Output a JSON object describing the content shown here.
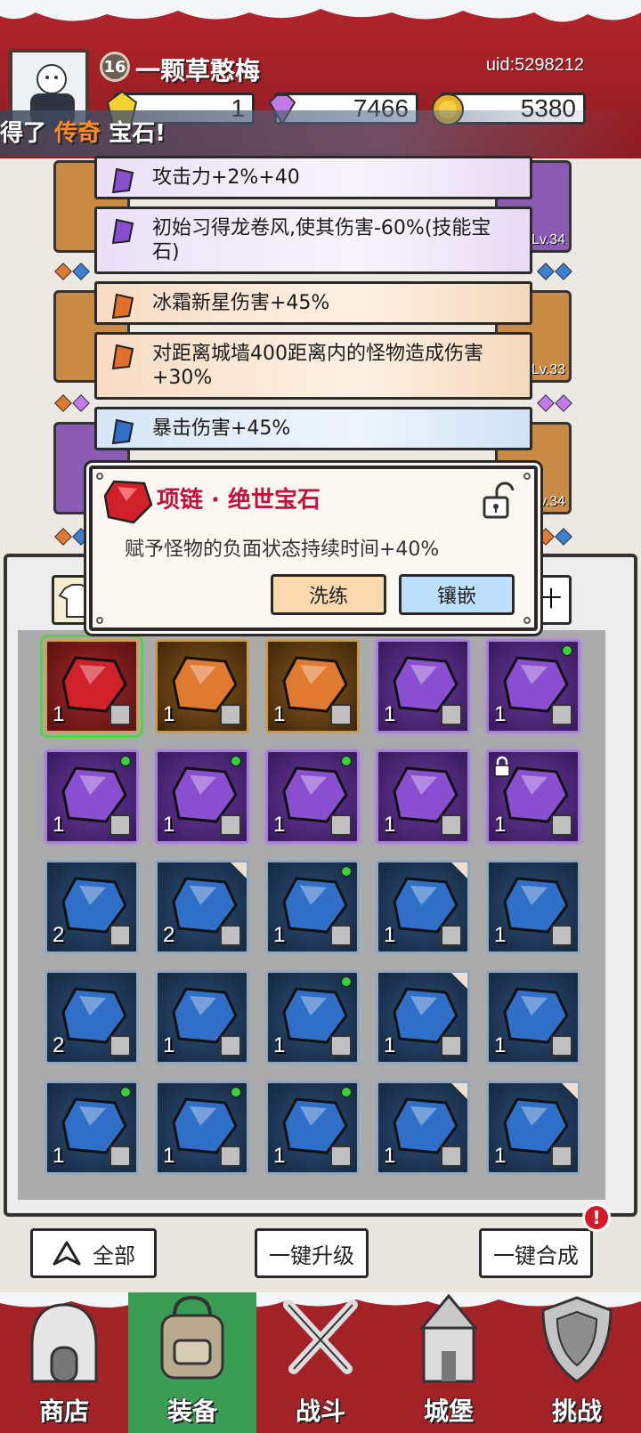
{
  "header": {
    "player_level": "16",
    "player_name": "一颗草憨梅",
    "uid": "uid:5298212",
    "currencies": [
      {
        "icon": "gold-gem-icon",
        "value": "1"
      },
      {
        "icon": "diamond-icon",
        "value": "7466"
      },
      {
        "icon": "coin-icon",
        "value": "5380"
      }
    ]
  },
  "banner": {
    "prefix": "得了",
    "highlight": "传奇",
    "suffix": "宝石!"
  },
  "equipment_levels": [
    "Lv.34",
    "Lv.33",
    "Lv.34"
  ],
  "attributes": [
    {
      "color": "purple",
      "text": "攻击力+2%+40"
    },
    {
      "color": "purple",
      "text": "初始习得龙卷风,使其伤害-60%(技能宝石)"
    },
    {
      "color": "orange",
      "text": "冰霜新星伤害+45%"
    },
    {
      "color": "orange",
      "text": "对距离城墙400距离内的怪物造成伤害+30%"
    },
    {
      "color": "blue",
      "text": "暴击伤害+45%"
    }
  ],
  "popup": {
    "title": "项链 · 绝世宝石",
    "description": "赋予怪物的负面状态持续时间+40%",
    "refine_label": "洗练",
    "inlay_label": "镶嵌"
  },
  "inventory_tab_right": "十",
  "inventory": [
    [
      {
        "color": "red",
        "count": "1",
        "slot": "necklace",
        "selected": true,
        "dot": false
      },
      {
        "color": "orange",
        "count": "1",
        "slot": "boots",
        "dot": false
      },
      {
        "color": "orange",
        "count": "1",
        "slot": "staff",
        "dot": false
      },
      {
        "color": "purple",
        "count": "1",
        "slot": "ring",
        "dot": false
      },
      {
        "color": "purple",
        "count": "1",
        "slot": "ring",
        "dot": true
      }
    ],
    [
      {
        "color": "purple",
        "count": "1",
        "slot": "armor",
        "dot": true
      },
      {
        "color": "purple",
        "count": "1",
        "slot": "armor",
        "dot": true
      },
      {
        "color": "purple",
        "count": "1",
        "slot": "boots",
        "dot": true
      },
      {
        "color": "purple",
        "count": "1",
        "slot": "staff",
        "dot": false
      },
      {
        "color": "purple",
        "count": "1",
        "slot": "staff",
        "dot": false,
        "locked": true
      }
    ],
    [
      {
        "color": "blue",
        "count": "2",
        "slot": "ring",
        "dot": false
      },
      {
        "color": "blue",
        "count": "2",
        "slot": "ring",
        "dot": false,
        "corner": true
      },
      {
        "color": "blue",
        "count": "1",
        "slot": "ring",
        "dot": true
      },
      {
        "color": "blue",
        "count": "1",
        "slot": "armor",
        "dot": false,
        "corner": true
      },
      {
        "color": "blue",
        "count": "1",
        "slot": "armor",
        "dot": false
      }
    ],
    [
      {
        "color": "blue",
        "count": "2",
        "slot": "armor",
        "dot": false
      },
      {
        "color": "blue",
        "count": "1",
        "slot": "armor",
        "dot": false
      },
      {
        "color": "blue",
        "count": "1",
        "slot": "armor",
        "dot": true
      },
      {
        "color": "blue",
        "count": "1",
        "slot": "boots",
        "dot": false,
        "corner": true
      },
      {
        "color": "blue",
        "count": "1",
        "slot": "staff",
        "dot": false
      }
    ],
    [
      {
        "color": "blue",
        "count": "1",
        "slot": "staff",
        "dot": true
      },
      {
        "color": "blue",
        "count": "1",
        "slot": "staff",
        "dot": true
      },
      {
        "color": "blue",
        "count": "1",
        "slot": "staff",
        "dot": true
      },
      {
        "color": "blue",
        "count": "1",
        "slot": "helmet",
        "dot": false,
        "corner": true
      },
      {
        "color": "blue",
        "count": "1",
        "slot": "helmet",
        "dot": false,
        "corner": true
      }
    ]
  ],
  "actions": {
    "filter_label": "全部",
    "upgrade_all_label": "一键升级",
    "merge_all_label": "一键合成",
    "alert": "!"
  },
  "nav": [
    {
      "label": "商店",
      "icon": "shop-icon",
      "active": false
    },
    {
      "label": "装备",
      "icon": "backpack-icon",
      "active": true
    },
    {
      "label": "战斗",
      "icon": "swords-icon",
      "active": false
    },
    {
      "label": "城堡",
      "icon": "castle-icon",
      "active": false
    },
    {
      "label": "挑战",
      "icon": "shield-icon",
      "active": false
    }
  ],
  "colors": {
    "header_red": "#a32228",
    "nav_active_green": "#3a9d55",
    "title_red": "#c2123a",
    "highlight_orange": "#ff8a2a",
    "gem_purple": "#8b5ab3",
    "gem_orange": "#e07a30",
    "gem_blue": "#3d7fd1",
    "gem_red": "#d0202a"
  }
}
